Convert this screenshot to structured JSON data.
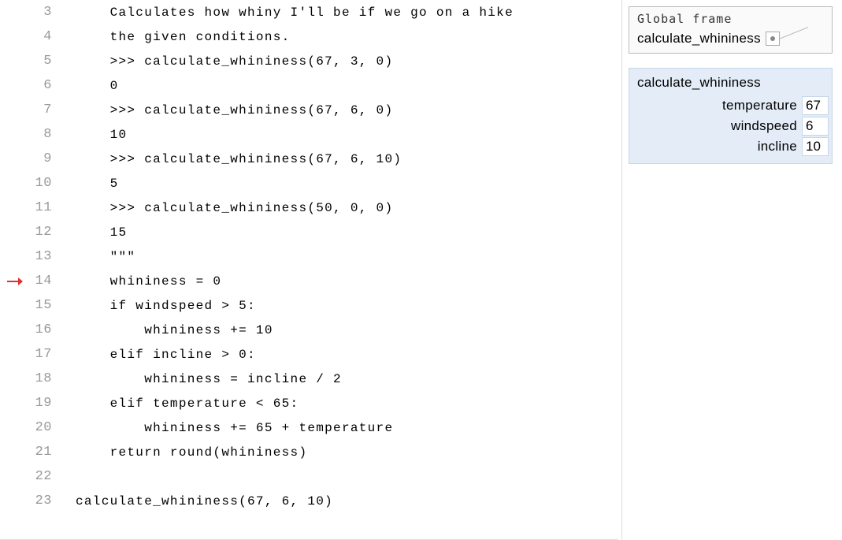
{
  "code": {
    "current_line": 14,
    "lines": [
      {
        "num": 3,
        "indent": "    ",
        "text": "Calculates how whiny I'll be if we go on a hike"
      },
      {
        "num": 4,
        "indent": "    ",
        "text": "the given conditions."
      },
      {
        "num": 5,
        "indent": "    ",
        "text": ">>> calculate_whininess(67, 3, 0)"
      },
      {
        "num": 6,
        "indent": "    ",
        "text": "0"
      },
      {
        "num": 7,
        "indent": "    ",
        "text": ">>> calculate_whininess(67, 6, 0)"
      },
      {
        "num": 8,
        "indent": "    ",
        "text": "10"
      },
      {
        "num": 9,
        "indent": "    ",
        "text": ">>> calculate_whininess(67, 6, 10)"
      },
      {
        "num": 10,
        "indent": "    ",
        "text": "5"
      },
      {
        "num": 11,
        "indent": "    ",
        "text": ">>> calculate_whininess(50, 0, 0)"
      },
      {
        "num": 12,
        "indent": "    ",
        "text": "15"
      },
      {
        "num": 13,
        "indent": "    ",
        "text": "\"\"\""
      },
      {
        "num": 14,
        "indent": "    ",
        "text": "whininess = 0"
      },
      {
        "num": 15,
        "indent": "    ",
        "text": "if windspeed > 5:"
      },
      {
        "num": 16,
        "indent": "        ",
        "text": "whininess += 10"
      },
      {
        "num": 17,
        "indent": "    ",
        "text": "elif incline > 0:"
      },
      {
        "num": 18,
        "indent": "        ",
        "text": "whininess = incline / 2"
      },
      {
        "num": 19,
        "indent": "    ",
        "text": "elif temperature < 65:"
      },
      {
        "num": 20,
        "indent": "        ",
        "text": "whininess += 65 + temperature"
      },
      {
        "num": 21,
        "indent": "    ",
        "text": "return round(whininess)"
      },
      {
        "num": 22,
        "indent": "",
        "text": ""
      },
      {
        "num": 23,
        "indent": "",
        "text": "calculate_whininess(67, 6, 10)"
      }
    ]
  },
  "frames": {
    "global": {
      "title": "Global frame",
      "entries": [
        {
          "name": "calculate_whininess"
        }
      ]
    },
    "local": {
      "title": "calculate_whininess",
      "vars": [
        {
          "name": "temperature",
          "value": "67"
        },
        {
          "name": "windspeed",
          "value": "6"
        },
        {
          "name": "incline",
          "value": "10"
        }
      ]
    }
  }
}
